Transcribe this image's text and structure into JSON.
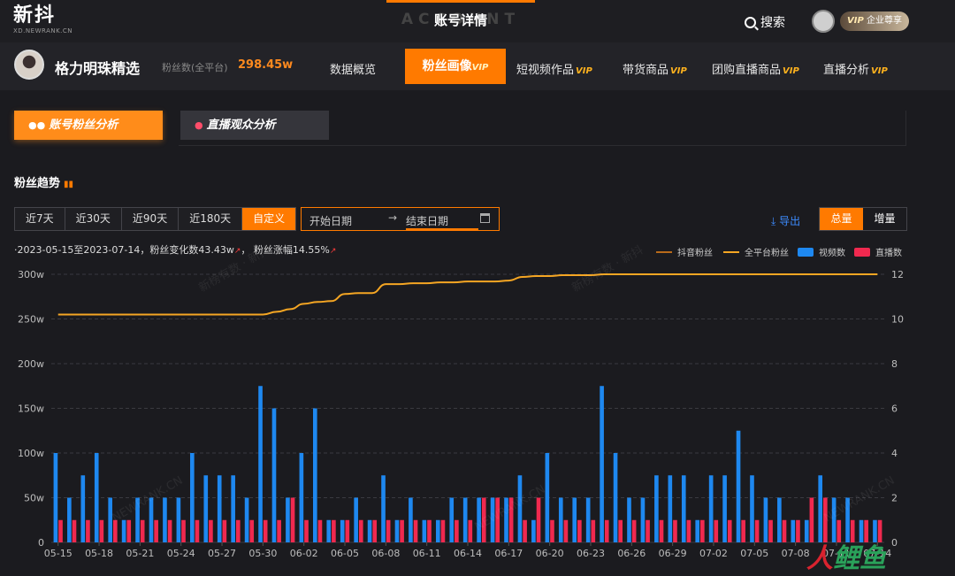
{
  "topbar": {
    "logo_main": "新抖",
    "logo_sub": "XD.NEWRANK.CN",
    "center_ghost": "ACCOUNT",
    "center_title": "账号详情",
    "search_label": "搜索",
    "vip_badge": "VIP",
    "vip_badge_text": "企业尊享"
  },
  "account": {
    "name": "格力明珠精选",
    "fans_label": "粉丝数(全平台)",
    "fans_value": "298.45w"
  },
  "nav": {
    "items": [
      {
        "label": "数据概览",
        "vip": ""
      },
      {
        "label": "粉丝画像",
        "vip": "VIP"
      },
      {
        "label": "短视频作品",
        "vip": "VIP"
      },
      {
        "label": "带货商品",
        "vip": "VIP"
      },
      {
        "label": "团购直播商品",
        "vip": "VIP"
      },
      {
        "label": "直播分析",
        "vip": "VIP"
      }
    ],
    "active_index": 1
  },
  "subtabs": {
    "a": "账号粉丝分析",
    "b": "直播观众分析"
  },
  "section": {
    "title": "粉丝趋势"
  },
  "ranges": [
    "近7天",
    "近30天",
    "近90天",
    "近180天",
    "自定义"
  ],
  "active_range": 4,
  "daterange": {
    "start_placeholder": "开始日期",
    "end_placeholder": "结束日期",
    "arrow": "→"
  },
  "export_label": "导出",
  "toggle": {
    "total": "总量",
    "increment": "增量"
  },
  "summary": {
    "text1": "·2023-05-15至2023-07-14，粉丝变化数43.43w",
    "text2": "粉丝涨幅14.55%"
  },
  "legend": {
    "douyin_fans": "抖音粉丝",
    "all_fans": "全平台粉丝",
    "videos": "视频数",
    "lives": "直播数"
  },
  "colors": {
    "accent": "#ff7a00",
    "douyin_line": "#b86a1a",
    "all_line": "#f5a623",
    "video_bar": "#1e88f0",
    "live_bar": "#f0294f",
    "vip": "#ffb21e"
  },
  "chart_data": {
    "type": "bar",
    "left_axis_ticks": [
      "0",
      "50w",
      "100w",
      "150w",
      "200w",
      "250w",
      "300w"
    ],
    "right_axis_ticks": [
      "0",
      "2",
      "4",
      "6",
      "8",
      "10",
      "12"
    ],
    "x_labels": [
      "05-15",
      "05-18",
      "05-21",
      "05-24",
      "05-27",
      "05-30",
      "06-02",
      "06-05",
      "06-08",
      "06-11",
      "06-14",
      "06-17",
      "06-20",
      "06-23",
      "06-26",
      "06-29",
      "07-02",
      "07-05",
      "07-08",
      "07-11",
      "07-14"
    ],
    "dates": [
      "05-15",
      "05-16",
      "05-17",
      "05-18",
      "05-19",
      "05-20",
      "05-21",
      "05-22",
      "05-23",
      "05-24",
      "05-25",
      "05-26",
      "05-27",
      "05-28",
      "05-29",
      "05-30",
      "05-31",
      "06-01",
      "06-02",
      "06-03",
      "06-04",
      "06-05",
      "06-06",
      "06-07",
      "06-08",
      "06-09",
      "06-10",
      "06-11",
      "06-12",
      "06-13",
      "06-14",
      "06-15",
      "06-16",
      "06-17",
      "06-18",
      "06-19",
      "06-20",
      "06-21",
      "06-22",
      "06-23",
      "06-24",
      "06-25",
      "06-26",
      "06-27",
      "06-28",
      "06-29",
      "06-30",
      "07-01",
      "07-02",
      "07-03",
      "07-04",
      "07-05",
      "07-06",
      "07-07",
      "07-08",
      "07-09",
      "07-10",
      "07-11",
      "07-12",
      "07-13",
      "07-14"
    ],
    "ylim_left": [
      0,
      300
    ],
    "ylim_right": [
      0,
      12
    ],
    "series": [
      {
        "name": "全平台粉丝",
        "axis": "left",
        "kind": "line",
        "values": [
          255,
          255,
          255,
          255,
          255,
          255,
          255,
          255,
          255,
          255,
          255,
          255,
          255,
          255,
          255,
          255,
          258,
          261,
          267,
          269,
          270,
          278,
          279,
          279,
          289,
          289,
          290,
          290,
          291,
          291,
          292,
          292,
          292,
          293,
          297,
          298,
          298,
          299,
          299,
          299,
          300,
          300,
          300,
          300,
          300,
          300,
          300,
          300,
          300,
          300,
          300,
          300,
          300,
          300,
          300,
          300,
          300,
          300,
          300,
          300,
          300
        ]
      },
      {
        "name": "视频数",
        "axis": "right",
        "kind": "bar",
        "values": [
          4,
          2,
          3,
          4,
          2,
          1,
          2,
          2,
          2,
          2,
          4,
          3,
          3,
          3,
          2,
          7,
          6,
          2,
          4,
          6,
          1,
          1,
          2,
          1,
          3,
          1,
          2,
          1,
          1,
          2,
          2,
          2,
          2,
          2,
          3,
          1,
          4,
          2,
          2,
          2,
          7,
          4,
          2,
          2,
          3,
          3,
          3,
          1,
          3,
          3,
          5,
          3,
          2,
          2,
          1,
          1,
          3,
          2,
          2,
          1,
          1
        ]
      },
      {
        "name": "直播数",
        "axis": "right",
        "kind": "bar",
        "values": [
          1,
          1,
          1,
          1,
          1,
          1,
          1,
          1,
          1,
          1,
          1,
          1,
          1,
          1,
          1,
          1,
          1,
          2,
          1,
          1,
          1,
          1,
          1,
          1,
          1,
          1,
          1,
          1,
          1,
          1,
          1,
          2,
          2,
          2,
          1,
          2,
          1,
          1,
          1,
          1,
          1,
          1,
          1,
          1,
          1,
          1,
          1,
          1,
          1,
          1,
          1,
          1,
          1,
          1,
          1,
          2,
          2,
          1,
          1,
          1,
          1
        ]
      }
    ]
  },
  "watermarks": [
    "新榜有数 · 新抖",
    "NEWRANK.CN"
  ],
  "corner_logo": "人鲤鱼"
}
